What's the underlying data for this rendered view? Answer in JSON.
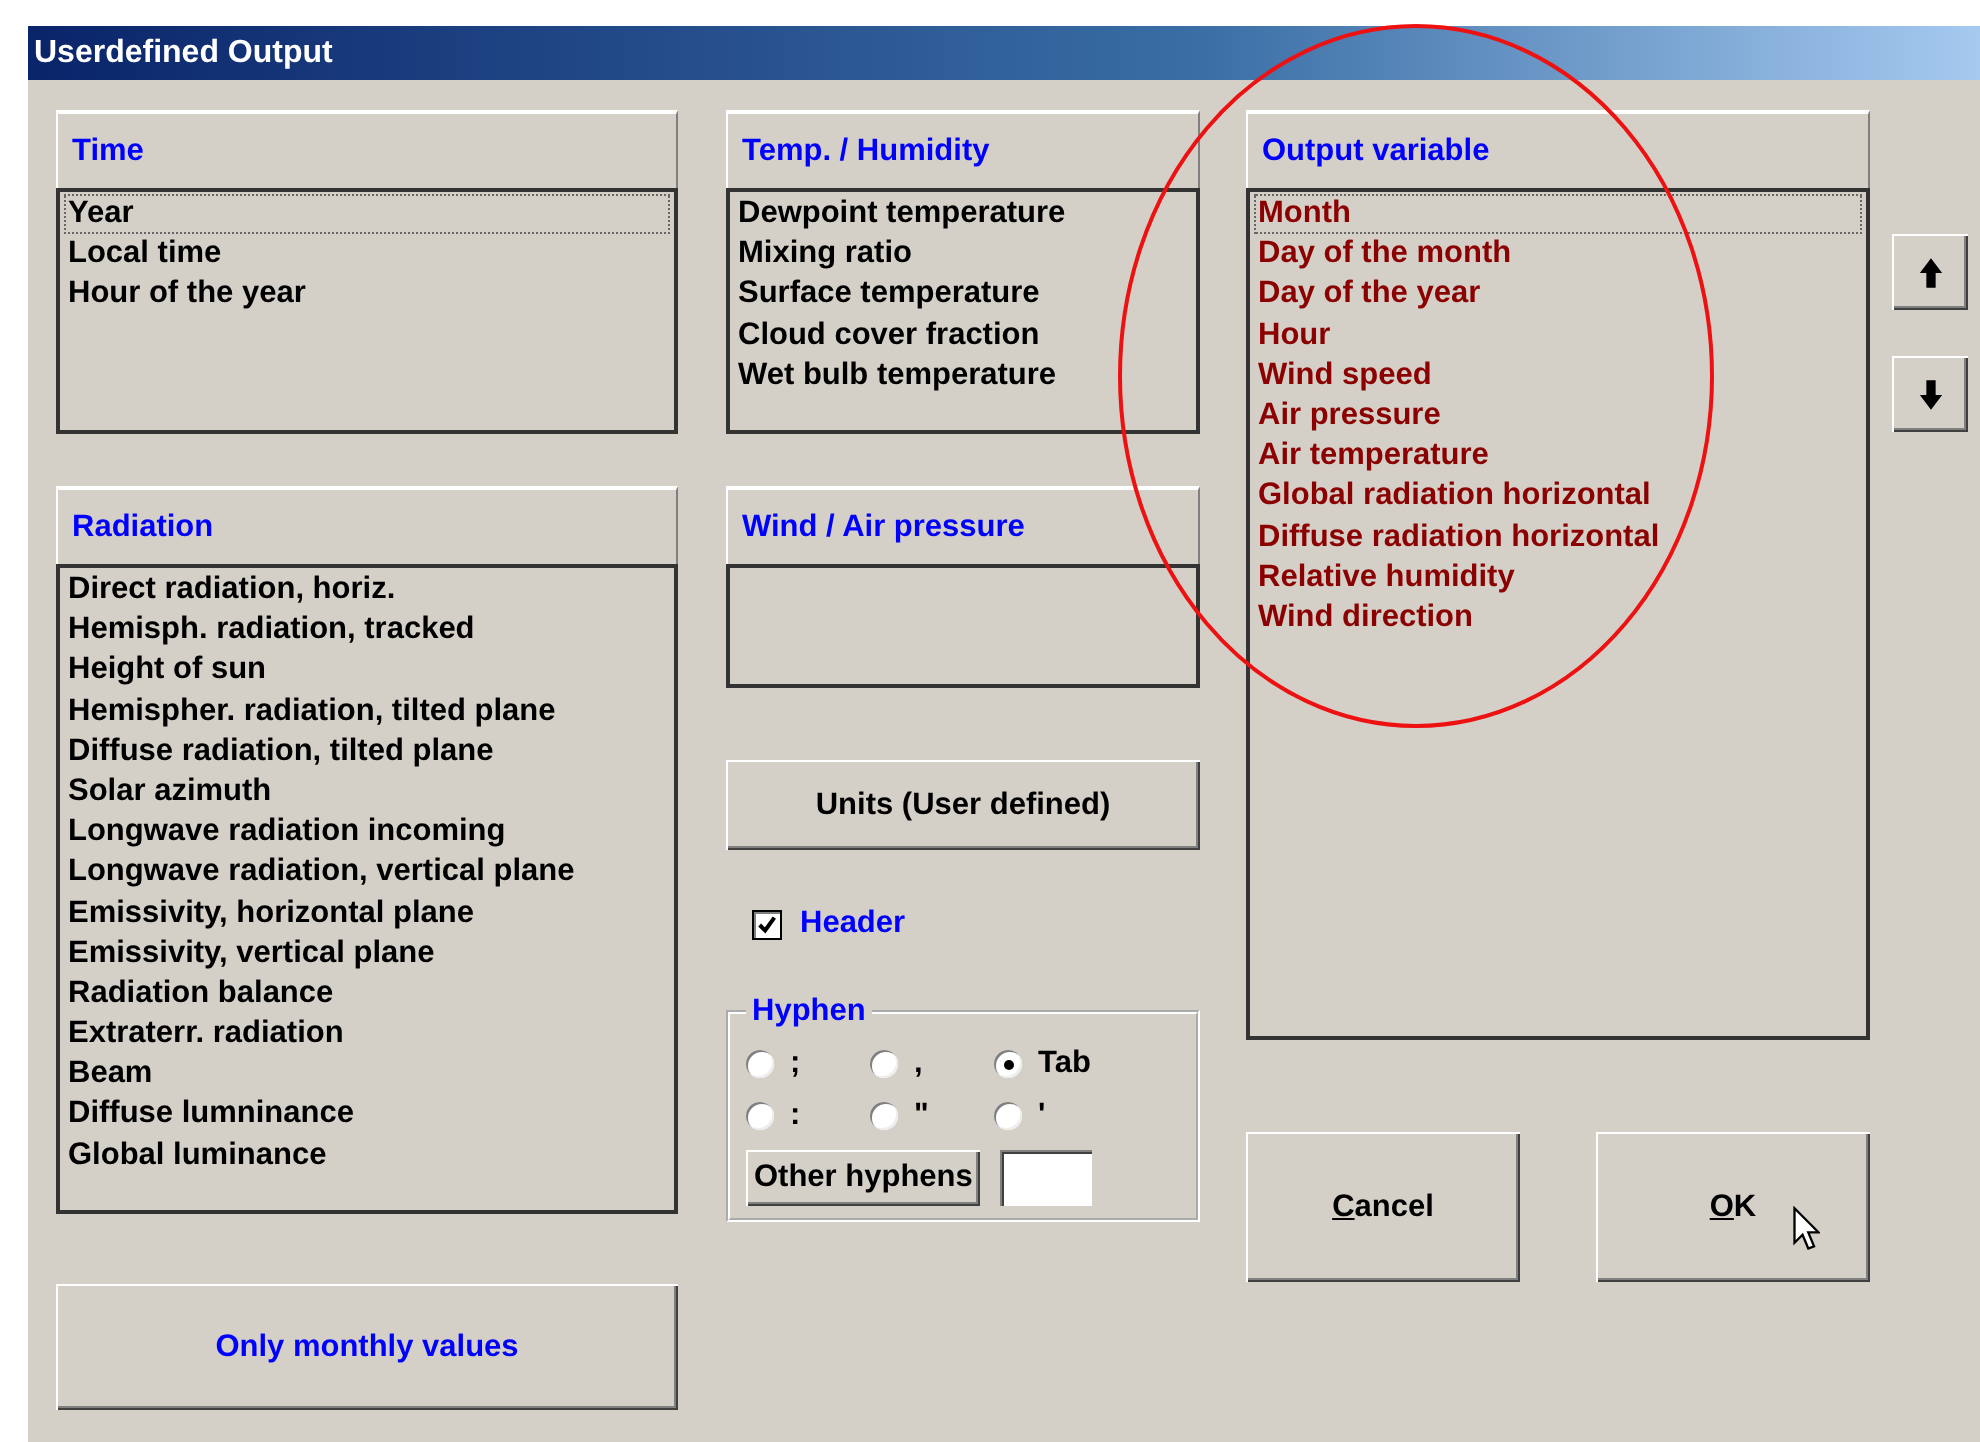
{
  "window": {
    "title": "Userdefined Output"
  },
  "time": {
    "title": "Time",
    "items": [
      {
        "label": "Year",
        "focused": true
      },
      {
        "label": "Local time",
        "focused": false
      },
      {
        "label": "Hour of the year",
        "focused": false
      }
    ]
  },
  "radiation": {
    "title": "Radiation",
    "items": [
      {
        "label": "Direct radiation, horiz.",
        "focused": false
      },
      {
        "label": "Hemisph. radiation, tracked",
        "focused": false
      },
      {
        "label": "Height of sun",
        "focused": false
      },
      {
        "label": "Hemispher. radiation, tilted plane",
        "focused": false
      },
      {
        "label": "Diffuse radiation, tilted plane",
        "focused": false
      },
      {
        "label": "Solar azimuth",
        "focused": false
      },
      {
        "label": "Longwave radiation incoming",
        "focused": false
      },
      {
        "label": "Longwave radiation, vertical plane",
        "focused": false
      },
      {
        "label": "Emissivity, horizontal plane",
        "focused": false
      },
      {
        "label": "Emissivity, vertical plane",
        "focused": false
      },
      {
        "label": "Radiation balance",
        "focused": false
      },
      {
        "label": "Extraterr. radiation",
        "focused": false
      },
      {
        "label": "Beam",
        "focused": false
      },
      {
        "label": "Diffuse lumninance",
        "focused": false
      },
      {
        "label": "Global luminance",
        "focused": false
      }
    ]
  },
  "monthly_button": "Only monthly values",
  "temp_humidity": {
    "title": "Temp. / Humidity",
    "items": [
      {
        "label": "Dewpoint temperature",
        "focused": false
      },
      {
        "label": "Mixing ratio",
        "focused": false
      },
      {
        "label": "Surface temperature",
        "focused": false
      },
      {
        "label": "Cloud cover fraction",
        "focused": false
      },
      {
        "label": "Wet bulb temperature",
        "focused": false
      }
    ]
  },
  "wind_pressure": {
    "title": "Wind / Air pressure"
  },
  "units_button": "Units (User defined)",
  "header_checkbox": {
    "label": "Header",
    "checked": true
  },
  "hyphen": {
    "title": "Hyphen",
    "options": [
      {
        "label": ";",
        "selected": false
      },
      {
        "label": ",",
        "selected": false
      },
      {
        "label": "Tab",
        "selected": true
      },
      {
        "label": ":",
        "selected": false
      },
      {
        "label": "\"",
        "selected": false
      },
      {
        "label": "'",
        "selected": false
      }
    ],
    "other_button": "Other hyphens"
  },
  "output": {
    "title": "Output variable",
    "items": [
      {
        "label": "Month",
        "focused": true
      },
      {
        "label": "Day of the month",
        "focused": false
      },
      {
        "label": "Day of the year",
        "focused": false
      },
      {
        "label": "Hour",
        "focused": false
      },
      {
        "label": "Wind speed",
        "focused": false
      },
      {
        "label": "Air pressure",
        "focused": false
      },
      {
        "label": "Air temperature",
        "focused": false
      },
      {
        "label": "Global radiation horizontal",
        "focused": false
      },
      {
        "label": "Diffuse radiation horizontal",
        "focused": false
      },
      {
        "label": "Relative humidity",
        "focused": false
      },
      {
        "label": "Wind direction",
        "focused": false
      }
    ]
  },
  "buttons": [
    {
      "label": "Cancel"
    },
    {
      "label": "OK"
    }
  ]
}
